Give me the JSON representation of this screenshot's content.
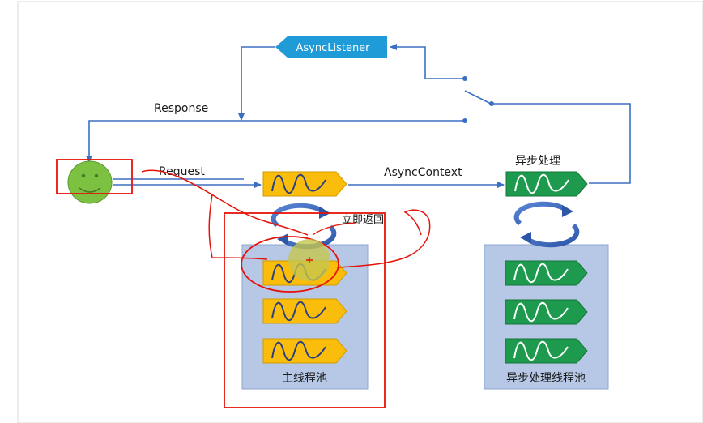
{
  "labels": {
    "async_listener": "AsyncListener",
    "response": "Response",
    "request": "Request",
    "async_context": "AsyncContext",
    "async_processing": "异步处理",
    "immediate_return": "立即返回",
    "main_pool": "主线程池",
    "async_pool": "异步处理线程池"
  },
  "colors": {
    "line_blue": "#3b6fc4",
    "listener_fill": "#1f9bd8",
    "main_thread_fill": "#fbbd0b",
    "async_thread_fill": "#1e9a4e",
    "pool_fill": "#b6c8e6",
    "annotation_red": "#e5130b",
    "smiley_fill": "#7cc142"
  },
  "icons": {
    "client": "smiley-face-icon",
    "thread": "wave-tag-icon",
    "cycle": "circular-arrows-icon"
  }
}
